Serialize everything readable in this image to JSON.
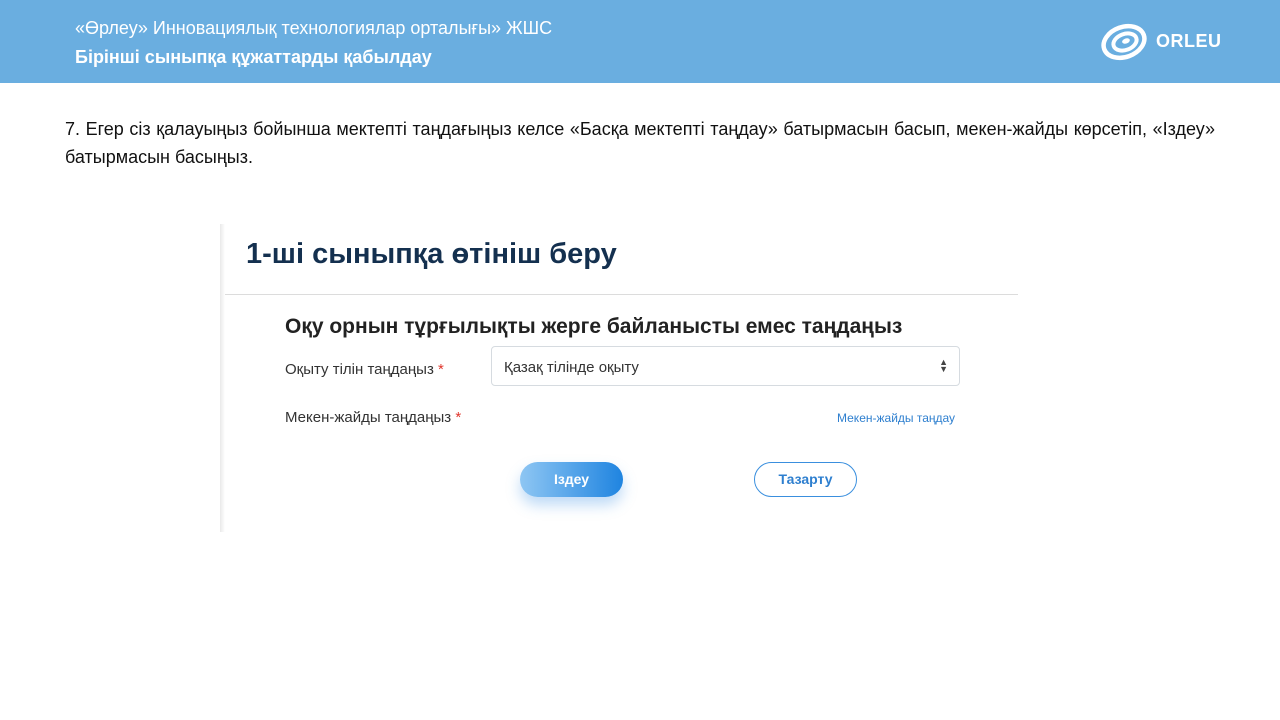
{
  "header": {
    "organization": "«Өрлеу» Инновациялық технологиялар орталығы» ЖШС",
    "subtitle": "Бірінші сыныпқа құжаттарды қабылдау",
    "logo_text": "ORLEU",
    "background_color": "#6aaee0"
  },
  "instruction": "7. Егер сіз қалауыңыз бойынша мектепті таңдағыңыз келсе «Басқа мектепті таңдау» батырмасын басып, мекен-жайды көрсетіп, «Іздеу» батырмасын басыңыз.",
  "form": {
    "title": "1-ші сыныпқа өтініш беру",
    "section_title": "Оқу орнын тұрғылықты жерге байланысты емес таңдаңыз",
    "language_label": "Оқыту тілін таңдаңыз",
    "language_value": "Қазақ тілінде оқыту",
    "address_label": "Мекен-жайды таңдаңыз",
    "address_link": "Мекен-жайды таңдау",
    "required_mark": "*",
    "search_button": "Іздеу",
    "clear_button": "Тазарту"
  }
}
